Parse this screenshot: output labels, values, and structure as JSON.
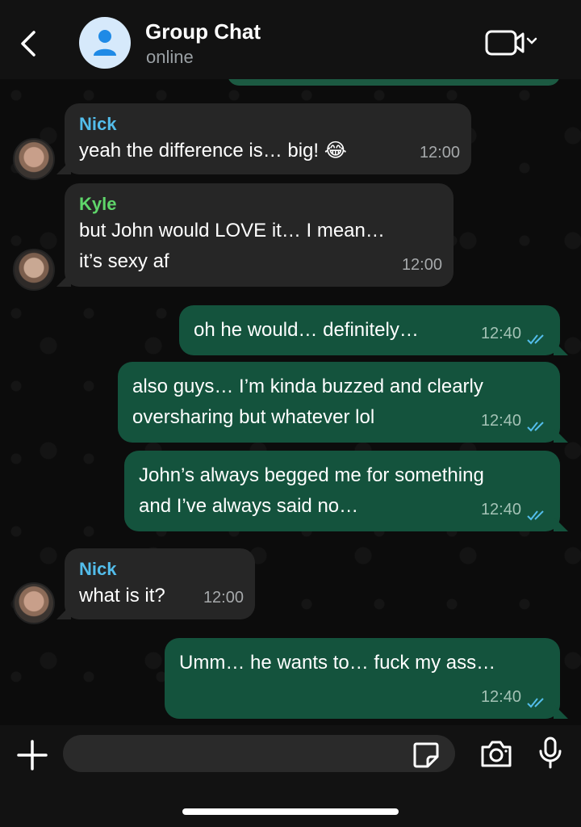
{
  "header": {
    "title": "Group Chat",
    "status": "online",
    "back_icon": "chevron-left-icon",
    "video_icon": "video-call-icon"
  },
  "messages": [
    {
      "direction": "in",
      "sender": "Nick",
      "text": "yeah the difference is… big! 😂",
      "time": "12:00"
    },
    {
      "direction": "in",
      "sender": "Kyle",
      "text_lines": [
        "but John would LOVE it… I mean…",
        "it’s sexy af"
      ],
      "time": "12:00"
    },
    {
      "direction": "out",
      "text": "oh he would… definitely…",
      "time": "12:40",
      "status": "read"
    },
    {
      "direction": "out",
      "text_lines": [
        "also guys… I’m kinda buzzed and clearly",
        "oversharing but whatever lol"
      ],
      "time": "12:40",
      "status": "read"
    },
    {
      "direction": "out",
      "text_lines": [
        "John’s always begged me for something",
        "and I’ve always said no…"
      ],
      "time": "12:40",
      "status": "read"
    },
    {
      "direction": "in",
      "sender": "Nick",
      "text": "what is it?",
      "time": "12:00"
    },
    {
      "direction": "out",
      "text": "Umm… he wants to… fuck my ass…",
      "time": "12:40",
      "status": "read"
    }
  ],
  "composer": {
    "placeholder": "",
    "icons": [
      "plus-icon",
      "sticker-icon",
      "camera-icon",
      "microphone-icon"
    ]
  },
  "colors": {
    "incoming_bubble": "#262626",
    "outgoing_bubble": "#14533d",
    "nick_name": "#53bdeb",
    "kyle_name": "#5fd66a",
    "read_ticks": "#53bdeb"
  }
}
